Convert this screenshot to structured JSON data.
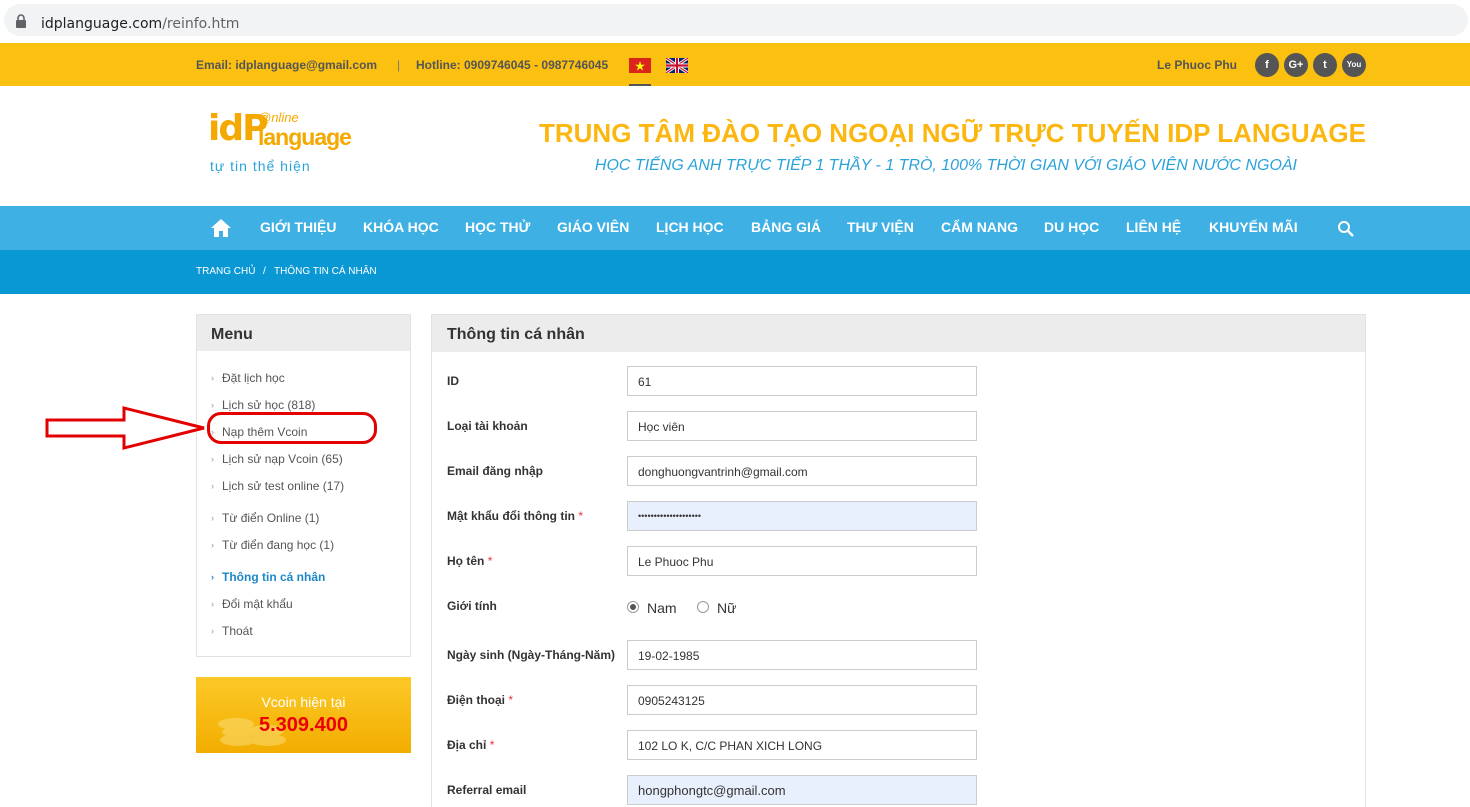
{
  "browser": {
    "url_host": "idplanguage.com",
    "url_path": "/reinfo.htm"
  },
  "topbar": {
    "email": "Email: idplanguage@gmail.com",
    "separator": "|",
    "hotline": "Hotline: 0909746045 - 0987746045",
    "user": "Le Phuoc Phu",
    "social": [
      {
        "icon": "facebook-icon",
        "glyph": "f"
      },
      {
        "icon": "google-plus-icon",
        "glyph": "G+"
      },
      {
        "icon": "twitter-icon",
        "glyph": "t"
      },
      {
        "icon": "youtube-icon",
        "glyph": "You"
      }
    ]
  },
  "header": {
    "logo_idp": "idP",
    "logo_online": "@nline",
    "logo_language": "language",
    "logo_tagline": "tự tin thể hiện",
    "title": "TRUNG TÂM ĐÀO TẠO NGOẠI NGỮ TRỰC TUYẾN IDP LANGUAGE",
    "subtitle": "HỌC TIẾNG ANH TRỰC TIẾP 1 THẦY - 1 TRÒ, 100% THỜI GIAN VỚI GIÁO VIÊN NƯỚC NGOÀI"
  },
  "nav": {
    "items": [
      "GIỚI THIỆU",
      "KHÓA HỌC",
      "HỌC THỬ",
      "GIÁO VIÊN",
      "LỊCH HỌC",
      "BẢNG GIÁ",
      "THƯ VIỆN",
      "CẨM NANG",
      "DU HỌC",
      "LIÊN HỆ",
      "KHUYẾN MÃI"
    ]
  },
  "breadcrumb": {
    "home": "TRANG CHỦ",
    "sep": "/",
    "current": "THÔNG TIN CÁ NHÂN"
  },
  "menu": {
    "title": "Menu",
    "items": [
      "Đặt lịch học",
      "Lịch sử học (818)",
      "Nạp thêm Vcoin",
      "Lịch sử nạp Vcoin (65)",
      "Lịch sử test online (17)",
      "Từ điển Online (1)",
      "Từ điển đang học (1)",
      "Thông tin cá nhân",
      "Đổi mật khẩu",
      "Thoát"
    ]
  },
  "vcoin": {
    "label": "Vcoin hiện tại",
    "value": "5.309.400"
  },
  "form": {
    "title": "Thông tin cá nhân",
    "required_mark": "*",
    "id_label": "ID",
    "id_value": "61",
    "type_label": "Loại tài khoản",
    "type_value": "Học viên",
    "email_label": "Email đăng nhập",
    "email_value": "donghuongvantrinh@gmail.com",
    "password_label": "Mật khẩu đổi thông tin",
    "password_value": "••••••••••••••••••••",
    "name_label": "Họ tên",
    "name_value": "Le Phuoc Phu",
    "gender_label": "Giới tính",
    "gender_male": "Nam",
    "gender_female": "Nữ",
    "gender_selected": "Nam",
    "dob_label": "Ngày sinh (Ngày-Tháng-Năm)",
    "dob_value": "19-02-1985",
    "phone_label": "Điện thoại",
    "phone_value": "0905243125",
    "address_label": "Địa chỉ",
    "address_value": "102 LO K, C/C PHAN XICH LONG",
    "referral_label": "Referral email",
    "referral_value": "hongphongtc@gmail.com"
  },
  "colors": {
    "topbar": "#fcc010",
    "nav": "#3fb0e4",
    "breadcrumb": "#0a98d4",
    "title": "#fbb710",
    "subtitle": "#2aa3d9",
    "annotation": "#e20000"
  }
}
